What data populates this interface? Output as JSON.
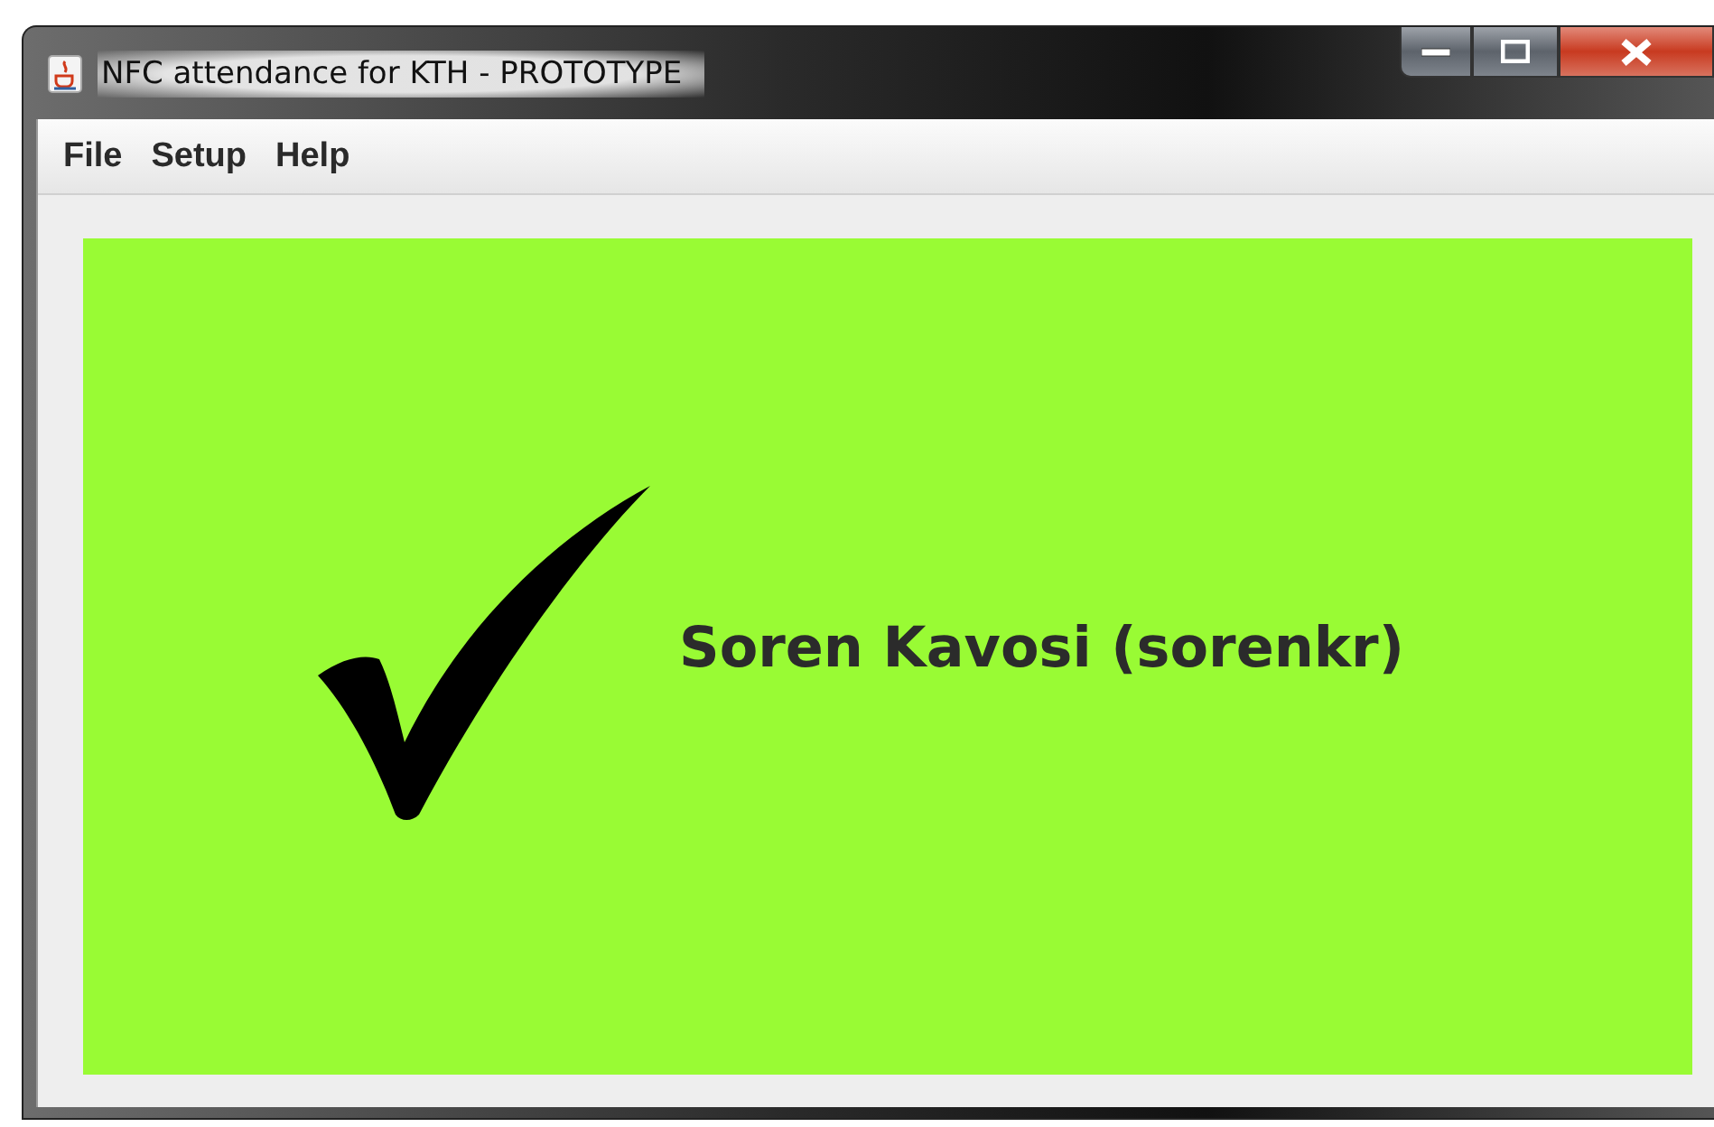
{
  "window": {
    "title": "NFC attendance for KTH - PROTOTYPE"
  },
  "menu": [
    {
      "label": "File"
    },
    {
      "label": "Setup"
    },
    {
      "label": "Help"
    }
  ],
  "status": {
    "kind": "accepted",
    "name": "Soren Kavosi (sorenkr)"
  }
}
